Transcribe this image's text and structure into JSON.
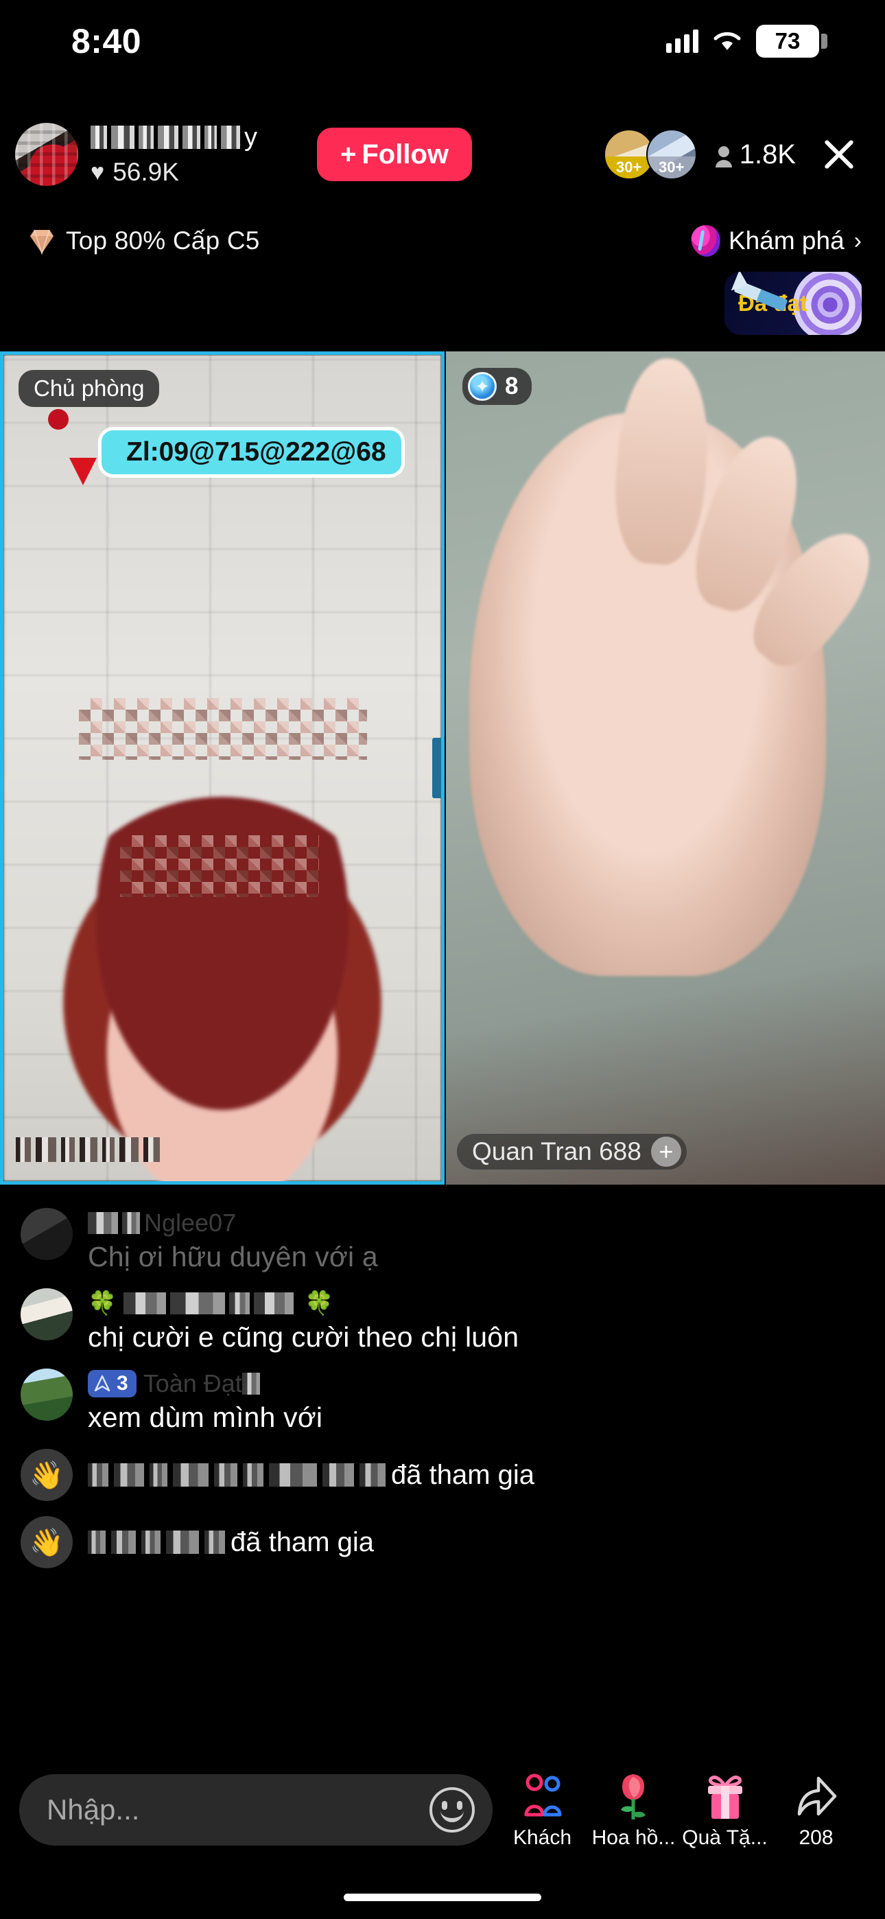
{
  "status_bar": {
    "time": "8:40",
    "battery": "73",
    "wifi_icon": "wifi-icon",
    "signal_icon": "cellular-signal-icon"
  },
  "header": {
    "host_name_visible_tail": "y",
    "host_name_redacted": true,
    "likes": "56.9K",
    "heart_icon": "heart-icon",
    "follow_label": "Follow",
    "follow_plus": "+",
    "follow_color": "#FE2C55",
    "viewer_badges": [
      {
        "label": "30+",
        "style": "gold"
      },
      {
        "label": "30+",
        "style": "silver"
      }
    ],
    "viewer_count": "1.8K",
    "viewer_icon": "person-icon",
    "close_icon": "close-icon"
  },
  "rank_row": {
    "gem_icon": "gem-icon",
    "rank_text": "Top 80% Cấp C5",
    "explore_label": "Khám phá",
    "explore_chevron": "›",
    "explore_icon": "explore-icon"
  },
  "achievement_badge": {
    "label": "Đã đạt",
    "label_color": "#f5c518",
    "icon": "dartboard-target-icon"
  },
  "stage": {
    "left_panel": {
      "role_badge": "Chủ phòng",
      "location_text": "Zl:09@715@222@68",
      "location_pin_icon": "map-pin-icon",
      "location_pill_color": "#5fe0ef",
      "border_color": "#29b6e8",
      "username_redacted": true
    },
    "right_panel": {
      "count_badge": "8",
      "count_badge_icon": "gem-blue-icon",
      "username": "Quan Tran 688",
      "add_icon": "plus-icon"
    }
  },
  "comments": [
    {
      "avatar": "av-dark",
      "name": "Nglee07",
      "name_redacted": true,
      "faded": true,
      "text": "Chị ơi hữu duyên với ạ",
      "badge": null
    },
    {
      "avatar": "av-girl",
      "name_prefix_emoji": "🍀",
      "name_suffix_emoji": "🍀",
      "name_redacted": true,
      "faded": false,
      "text": "chị cười e cũng cười theo chị luôn",
      "badge": null
    },
    {
      "avatar": "av-palm",
      "name": "Toàn Đạt",
      "name_redacted": true,
      "faded": false,
      "text": "xem dùm mình với",
      "badge": {
        "level": "3",
        "icon": "level-arrow-icon",
        "color": "#3b5fc0"
      }
    }
  ],
  "join_messages": [
    {
      "icon": "wave-hand-icon",
      "suffix": "đã tham gia",
      "name_redacted": true
    },
    {
      "icon": "wave-hand-icon",
      "suffix": "đã tham gia",
      "name_redacted": true
    }
  ],
  "bottom_bar": {
    "input_placeholder": "Nhập...",
    "emoji_icon": "smiley-icon",
    "actions": [
      {
        "icon": "guests-icon",
        "label": "Khách"
      },
      {
        "icon": "rose-icon",
        "label": "Hoa hồ..."
      },
      {
        "icon": "gift-icon",
        "label": "Quà Tặ..."
      },
      {
        "icon": "share-icon",
        "label": "208"
      }
    ]
  }
}
